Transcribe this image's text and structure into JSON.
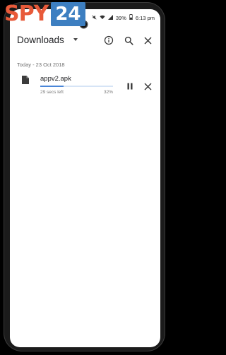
{
  "brand": {
    "spy": "SPY",
    "num": "24"
  },
  "status_bar": {
    "battery_percent": "39%",
    "time": "6:13 pm"
  },
  "app_bar": {
    "title": "Downloads",
    "icons": [
      "info-icon",
      "search-icon",
      "close-icon"
    ]
  },
  "downloads": {
    "date_header": "Today - 23 Oct 2018",
    "items": [
      {
        "name": "appv2.apk",
        "time_left": "29 secs left",
        "percent_label": "32%",
        "progress": 0.32,
        "icon": "file-icon"
      }
    ]
  },
  "colors": {
    "brand_spy": "#e85a3a",
    "brand_24_bg": "#3d7fc1",
    "progress": "#4a86d8",
    "progress_track": "#d6e4f6"
  }
}
